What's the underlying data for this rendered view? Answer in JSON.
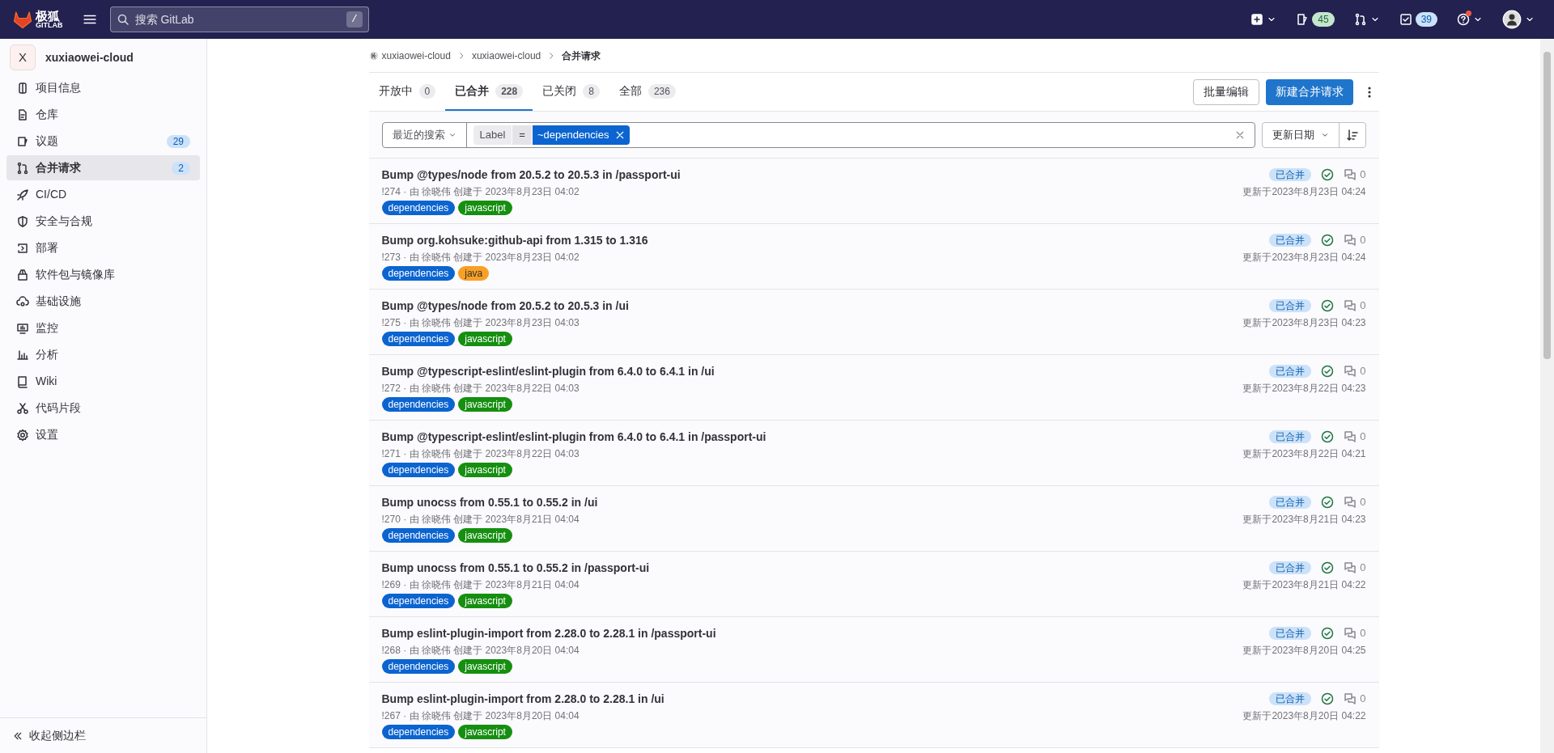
{
  "top_bar": {
    "logo_text": "极狐",
    "logo_subtext": "GITLAB",
    "search": {
      "placeholder": "搜索 GitLab",
      "shortcut": "/"
    },
    "issues_count": "45",
    "todos_count": "39",
    "help_notification": true
  },
  "sidebar": {
    "project_initial": "X",
    "project_name": "xuxiaowei-cloud",
    "items": [
      {
        "label": "项目信息",
        "selected": false
      },
      {
        "label": "仓库",
        "selected": false
      },
      {
        "label": "议题",
        "count": "29",
        "selected": false
      },
      {
        "label": "合并请求",
        "count": "2",
        "selected": true
      },
      {
        "label": "CI/CD",
        "selected": false
      },
      {
        "label": "安全与合规",
        "selected": false
      },
      {
        "label": "部署",
        "selected": false
      },
      {
        "label": "软件包与镜像库",
        "selected": false
      },
      {
        "label": "基础设施",
        "selected": false
      },
      {
        "label": "监控",
        "selected": false
      },
      {
        "label": "分析",
        "selected": false
      },
      {
        "label": "Wiki",
        "selected": false
      },
      {
        "label": "代码片段",
        "selected": false
      },
      {
        "label": "设置",
        "selected": false
      }
    ],
    "collapse": "收起侧边栏"
  },
  "breadcrumbs": [
    "xuxiaowei-cloud",
    "xuxiaowei-cloud",
    "合并请求"
  ],
  "tabs": [
    {
      "label": "开放中",
      "count": "0",
      "selected": false
    },
    {
      "label": "已合并",
      "count": "228",
      "selected": true
    },
    {
      "label": "已关闭",
      "count": "8",
      "selected": false
    },
    {
      "label": "全部",
      "count": "236",
      "selected": false
    }
  ],
  "buttons": {
    "bulk_edit": "批量编辑",
    "new_merge_request": "新建合并请求"
  },
  "filter": {
    "recent_searches": "最近的搜索",
    "token": {
      "name": "Label",
      "operator": "=",
      "value": "~dependencies"
    },
    "sort": "更新日期"
  },
  "merge_requests": [
    {
      "title": "Bump @types/node from 20.5.2 to 20.5.3 in /passport-ui",
      "meta": "!274 · 由 徐晓伟 创建于 2023年8月23日 04:02",
      "labels": [
        {
          "text": "dependencies",
          "color": "#0b64d0"
        },
        {
          "text": "javascript",
          "color": "#168f11"
        }
      ],
      "status": "已合并",
      "pipeline_passed": true,
      "comments": "0",
      "updated": "更新于2023年8月23日 04:24"
    },
    {
      "title": "Bump org.kohsuke:github-api from 1.315 to 1.316",
      "meta": "!273 · 由 徐晓伟 创建于 2023年8月23日 04:02",
      "labels": [
        {
          "text": "dependencies",
          "color": "#0b64d0"
        },
        {
          "text": "java",
          "color": "#f8a023"
        }
      ],
      "status": "已合并",
      "pipeline_passed": true,
      "comments": "0",
      "updated": "更新于2023年8月23日 04:24"
    },
    {
      "title": "Bump @types/node from 20.5.2 to 20.5.3 in /ui",
      "meta": "!275 · 由 徐晓伟 创建于 2023年8月23日 04:03",
      "labels": [
        {
          "text": "dependencies",
          "color": "#0b64d0"
        },
        {
          "text": "javascript",
          "color": "#168f11"
        }
      ],
      "status": "已合并",
      "pipeline_passed": true,
      "comments": "0",
      "updated": "更新于2023年8月23日 04:23"
    },
    {
      "title": "Bump @typescript-eslint/eslint-plugin from 6.4.0 to 6.4.1 in /ui",
      "meta": "!272 · 由 徐晓伟 创建于 2023年8月22日 04:03",
      "labels": [
        {
          "text": "dependencies",
          "color": "#0b64d0"
        },
        {
          "text": "javascript",
          "color": "#168f11"
        }
      ],
      "status": "已合并",
      "pipeline_passed": true,
      "comments": "0",
      "updated": "更新于2023年8月22日 04:23"
    },
    {
      "title": "Bump @typescript-eslint/eslint-plugin from 6.4.0 to 6.4.1 in /passport-ui",
      "meta": "!271 · 由 徐晓伟 创建于 2023年8月22日 04:03",
      "labels": [
        {
          "text": "dependencies",
          "color": "#0b64d0"
        },
        {
          "text": "javascript",
          "color": "#168f11"
        }
      ],
      "status": "已合并",
      "pipeline_passed": true,
      "comments": "0",
      "updated": "更新于2023年8月22日 04:21"
    },
    {
      "title": "Bump unocss from 0.55.1 to 0.55.2 in /ui",
      "meta": "!270 · 由 徐晓伟 创建于 2023年8月21日 04:04",
      "labels": [
        {
          "text": "dependencies",
          "color": "#0b64d0"
        },
        {
          "text": "javascript",
          "color": "#168f11"
        }
      ],
      "status": "已合并",
      "pipeline_passed": true,
      "comments": "0",
      "updated": "更新于2023年8月21日 04:23"
    },
    {
      "title": "Bump unocss from 0.55.1 to 0.55.2 in /passport-ui",
      "meta": "!269 · 由 徐晓伟 创建于 2023年8月21日 04:04",
      "labels": [
        {
          "text": "dependencies",
          "color": "#0b64d0"
        },
        {
          "text": "javascript",
          "color": "#168f11"
        }
      ],
      "status": "已合并",
      "pipeline_passed": true,
      "comments": "0",
      "updated": "更新于2023年8月21日 04:22"
    },
    {
      "title": "Bump eslint-plugin-import from 2.28.0 to 2.28.1 in /passport-ui",
      "meta": "!268 · 由 徐晓伟 创建于 2023年8月20日 04:04",
      "labels": [
        {
          "text": "dependencies",
          "color": "#0b64d0"
        },
        {
          "text": "javascript",
          "color": "#168f11"
        }
      ],
      "status": "已合并",
      "pipeline_passed": true,
      "comments": "0",
      "updated": "更新于2023年8月20日 04:25"
    },
    {
      "title": "Bump eslint-plugin-import from 2.28.0 to 2.28.1 in /ui",
      "meta": "!267 · 由 徐晓伟 创建于 2023年8月20日 04:04",
      "labels": [
        {
          "text": "dependencies",
          "color": "#0b64d0"
        },
        {
          "text": "javascript",
          "color": "#168f11"
        }
      ],
      "status": "已合并",
      "pipeline_passed": true,
      "comments": "0",
      "updated": "更新于2023年8月20日 04:22"
    }
  ]
}
